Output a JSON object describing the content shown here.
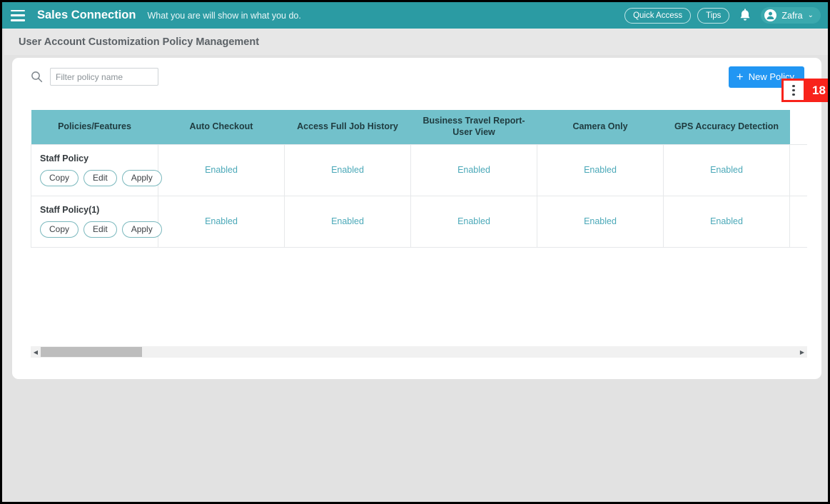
{
  "app": {
    "brand": "Sales Connection",
    "tagline": "What you are will show in what you do.",
    "menu_icon": "hamburger-icon"
  },
  "header": {
    "quick_access_label": "Quick Access",
    "tips_label": "Tips",
    "notification_icon": "bell-icon",
    "user_name": "Zafra",
    "user_chevron": "⌄",
    "avatar_icon": "user-avatar-icon"
  },
  "page": {
    "title": "User Account Customization Policy Management"
  },
  "toolbar": {
    "search_icon": "search-icon",
    "filter_placeholder": "Filter policy name",
    "filter_value": "",
    "new_policy_label": "New Policy",
    "new_policy_plus": "+",
    "kebab_icon": "vertical-dots-icon",
    "step_badge": "18"
  },
  "table": {
    "columns": [
      "Policies/Features",
      "Auto Checkout",
      "Access Full Job History",
      "Business Travel Report-User View",
      "Camera Only",
      "GPS Accuracy Detection",
      ""
    ],
    "row_action_labels": [
      "Copy",
      "Edit",
      "Apply"
    ],
    "rows": [
      {
        "name": "Staff Policy",
        "values": [
          "Enabled",
          "Enabled",
          "Enabled",
          "Enabled",
          "Enabled",
          ""
        ]
      },
      {
        "name": "Staff Policy(1)",
        "values": [
          "Enabled",
          "Enabled",
          "Enabled",
          "Enabled",
          "Enabled",
          ""
        ]
      }
    ]
  },
  "scrollbar": {
    "left_arrow": "◀",
    "right_arrow": "▶"
  },
  "colors": {
    "brand_teal": "#2b9ba3",
    "table_header_teal": "#72c1cb",
    "enabled_text": "#4aa8b8",
    "primary_blue": "#2196f3",
    "highlight_red": "#f8231b",
    "page_bg": "#e2e2e2"
  }
}
